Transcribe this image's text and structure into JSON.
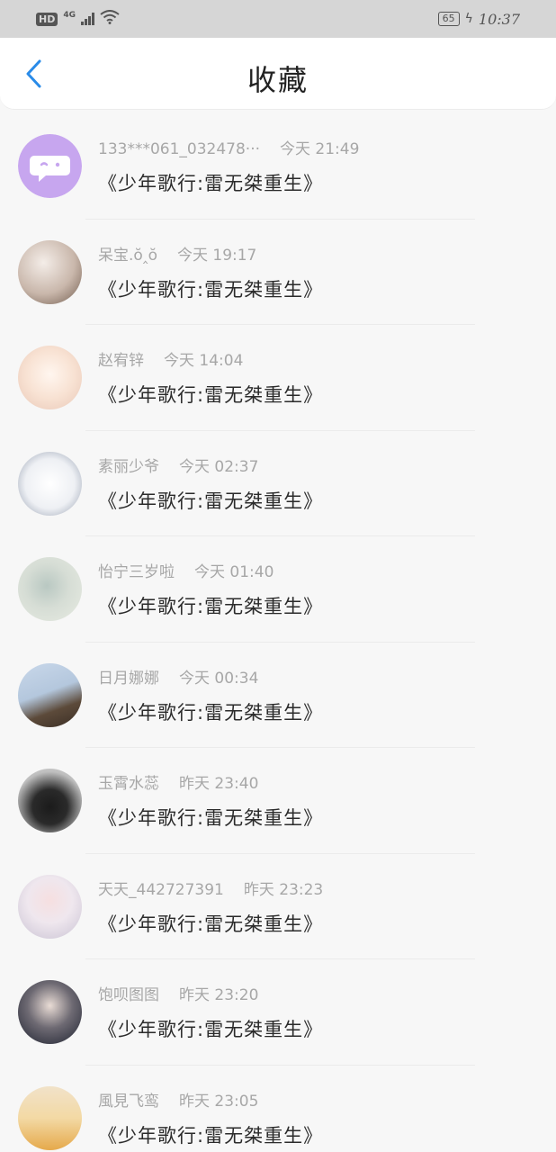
{
  "status_bar": {
    "hd_label": "HD",
    "network_label": "4G",
    "battery_level": "65",
    "time": "10:37"
  },
  "header": {
    "title": "收藏",
    "back_icon": "chevron-left-icon",
    "accent_color": "#2a8be8"
  },
  "favorites": [
    {
      "name": "133***061_032478···",
      "time": "今天 21:49",
      "content": "《少年歌行:雷无桀重生》",
      "avatar": "default-avatar-purple"
    },
    {
      "name": "呆宝.ŏ‸ŏ",
      "time": "今天 19:17",
      "content": "《少年歌行:雷无桀重生》",
      "avatar": "photo-avatar"
    },
    {
      "name": "赵宥锌",
      "time": "今天 14:04",
      "content": "《少年歌行:雷无桀重生》",
      "avatar": "photo-avatar"
    },
    {
      "name": "素丽少爷",
      "time": "今天 02:37",
      "content": "《少年歌行:雷无桀重生》",
      "avatar": "photo-avatar"
    },
    {
      "name": "怡宁三岁啦",
      "time": "今天 01:40",
      "content": "《少年歌行:雷无桀重生》",
      "avatar": "photo-avatar"
    },
    {
      "name": "日月娜娜",
      "time": "今天 00:34",
      "content": "《少年歌行:雷无桀重生》",
      "avatar": "photo-avatar"
    },
    {
      "name": "玉霄水蕊",
      "time": "昨天 23:40",
      "content": "《少年歌行:雷无桀重生》",
      "avatar": "photo-avatar"
    },
    {
      "name": "天天_442727391",
      "time": "昨天 23:23",
      "content": "《少年歌行:雷无桀重生》",
      "avatar": "photo-avatar"
    },
    {
      "name": "饱呗图图",
      "time": "昨天 23:20",
      "content": "《少年歌行:雷无桀重生》",
      "avatar": "photo-avatar"
    },
    {
      "name": "風見飞鸾",
      "time": "昨天 23:05",
      "content": "《少年歌行:雷无桀重生》",
      "avatar": "photo-avatar"
    }
  ]
}
